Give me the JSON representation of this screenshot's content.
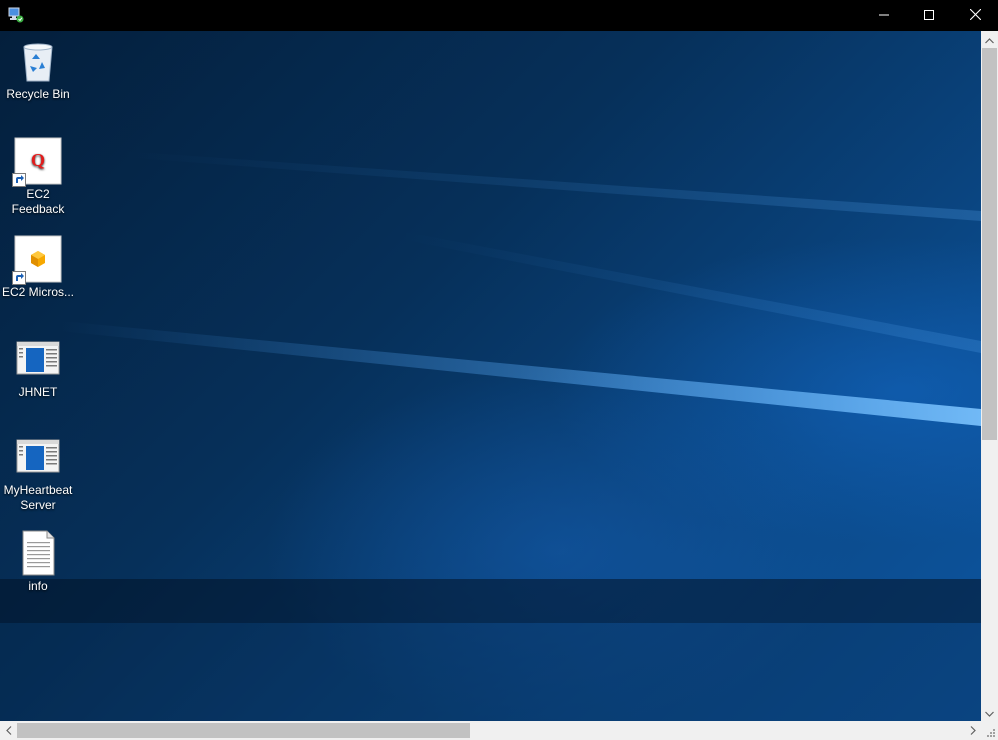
{
  "window": {
    "icon": "remote-desktop-icon",
    "controls": {
      "minimize_icon": "minimize-icon",
      "maximize_icon": "maximize-icon",
      "close_icon": "close-icon"
    }
  },
  "desktop": {
    "icons": [
      {
        "label": "Recycle Bin",
        "icon": "recycle-bin-icon",
        "shortcut": false
      },
      {
        "label": "EC2 Feedback",
        "icon": "ec2-feedback-icon",
        "shortcut": true
      },
      {
        "label": "EC2 Micros...",
        "icon": "ec2-microsoft-icon",
        "shortcut": true
      },
      {
        "label": "JHNET",
        "icon": "jhnet-app-icon",
        "shortcut": false
      },
      {
        "label": "MyHeartbeat Server",
        "icon": "myheartbeat-app-icon",
        "shortcut": false
      },
      {
        "label": "info",
        "icon": "text-document-icon",
        "shortcut": false
      }
    ]
  },
  "colors": {
    "titlebar": "#000000",
    "desktop_dark": "#041f3c",
    "desktop_light": "#0d55a0",
    "scrollbar_track": "#f0f0f0",
    "scrollbar_thumb": "#c2c2c2",
    "feedback_q": "#e21b1b",
    "ec2_cube": "#f7a800"
  }
}
